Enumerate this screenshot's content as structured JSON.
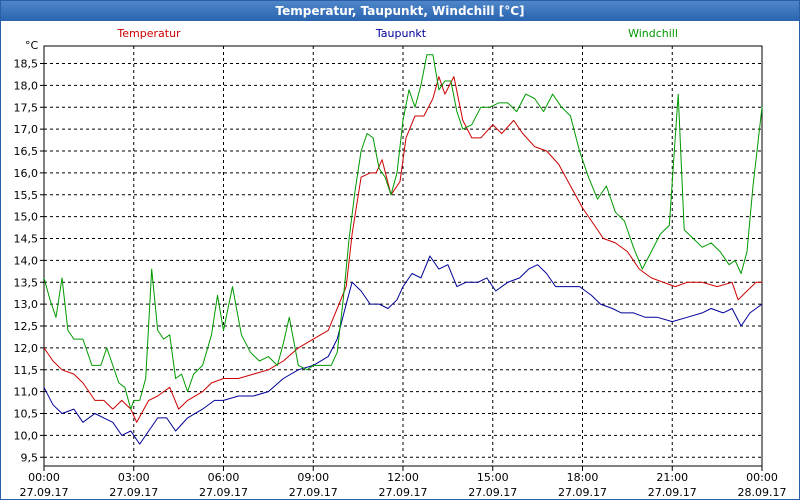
{
  "window": {
    "title": "Temperatur, Taupunkt, Windchill [°C]"
  },
  "chart_data": {
    "type": "line",
    "title": "Temperatur, Taupunkt, Windchill [°C]",
    "ylabel": "°C",
    "ylim": [
      9.3,
      18.9
    ],
    "y_ticks": [
      "9,5",
      "10,0",
      "10,5",
      "11,0",
      "11,5",
      "12,0",
      "12,5",
      "13,0",
      "13,5",
      "14,0",
      "14,5",
      "15,0",
      "15,5",
      "16,0",
      "16,5",
      "17,0",
      "17,5",
      "18,0",
      "18,5"
    ],
    "y_tick_values": [
      9.5,
      10,
      10.5,
      11,
      11.5,
      12,
      12.5,
      13,
      13.5,
      14,
      14.5,
      15,
      15.5,
      16,
      16.5,
      17,
      17.5,
      18,
      18.5
    ],
    "x_range_hours": [
      0,
      24
    ],
    "x_ticks": [
      {
        "h": 0,
        "time": "00:00",
        "date": "27.09.17"
      },
      {
        "h": 3,
        "time": "03:00",
        "date": "27.09.17"
      },
      {
        "h": 6,
        "time": "06:00",
        "date": "27.09.17"
      },
      {
        "h": 9,
        "time": "09:00",
        "date": "27.09.17"
      },
      {
        "h": 12,
        "time": "12:00",
        "date": "27.09.17"
      },
      {
        "h": 15,
        "time": "15:00",
        "date": "27.09.17"
      },
      {
        "h": 18,
        "time": "18:00",
        "date": "27.09.17"
      },
      {
        "h": 21,
        "time": "21:00",
        "date": "27.09.17"
      },
      {
        "h": 24,
        "time": "00:00",
        "date": "28.09.17"
      }
    ],
    "grid": true,
    "legend_position": "top",
    "series": [
      {
        "name": "Temperatur",
        "color": "#cc0000",
        "points": [
          [
            0,
            12.0
          ],
          [
            0.3,
            11.7
          ],
          [
            0.6,
            11.5
          ],
          [
            1.0,
            11.4
          ],
          [
            1.3,
            11.2
          ],
          [
            1.7,
            10.8
          ],
          [
            2.0,
            10.8
          ],
          [
            2.3,
            10.6
          ],
          [
            2.6,
            10.8
          ],
          [
            2.9,
            10.6
          ],
          [
            3.1,
            10.3
          ],
          [
            3.5,
            10.8
          ],
          [
            3.8,
            10.9
          ],
          [
            4.2,
            11.1
          ],
          [
            4.5,
            10.6
          ],
          [
            4.8,
            10.8
          ],
          [
            5.3,
            11.0
          ],
          [
            5.6,
            11.2
          ],
          [
            6.0,
            11.3
          ],
          [
            6.5,
            11.3
          ],
          [
            7.0,
            11.4
          ],
          [
            7.5,
            11.5
          ],
          [
            8.0,
            11.7
          ],
          [
            8.5,
            12.0
          ],
          [
            9.0,
            12.2
          ],
          [
            9.5,
            12.4
          ],
          [
            9.8,
            12.9
          ],
          [
            10.1,
            13.4
          ],
          [
            10.3,
            14.6
          ],
          [
            10.6,
            15.9
          ],
          [
            10.9,
            16.0
          ],
          [
            11.1,
            16.0
          ],
          [
            11.3,
            16.3
          ],
          [
            11.6,
            15.5
          ],
          [
            11.9,
            15.8
          ],
          [
            12.1,
            16.8
          ],
          [
            12.4,
            17.3
          ],
          [
            12.7,
            17.3
          ],
          [
            13.0,
            17.7
          ],
          [
            13.2,
            18.2
          ],
          [
            13.4,
            17.8
          ],
          [
            13.7,
            18.2
          ],
          [
            14.0,
            17.2
          ],
          [
            14.3,
            16.8
          ],
          [
            14.6,
            16.8
          ],
          [
            15.0,
            17.1
          ],
          [
            15.3,
            16.9
          ],
          [
            15.7,
            17.2
          ],
          [
            16.0,
            16.9
          ],
          [
            16.4,
            16.6
          ],
          [
            16.8,
            16.5
          ],
          [
            17.2,
            16.2
          ],
          [
            17.6,
            15.7
          ],
          [
            18.0,
            15.2
          ],
          [
            18.4,
            14.8
          ],
          [
            18.7,
            14.5
          ],
          [
            19.1,
            14.4
          ],
          [
            19.5,
            14.2
          ],
          [
            19.9,
            13.8
          ],
          [
            20.3,
            13.6
          ],
          [
            20.7,
            13.5
          ],
          [
            21.1,
            13.4
          ],
          [
            21.5,
            13.5
          ],
          [
            22.0,
            13.5
          ],
          [
            22.5,
            13.4
          ],
          [
            23.0,
            13.5
          ],
          [
            23.2,
            13.1
          ],
          [
            23.5,
            13.3
          ],
          [
            23.8,
            13.5
          ],
          [
            24.0,
            13.5
          ]
        ]
      },
      {
        "name": "Taupunkt",
        "color": "#000099",
        "points": [
          [
            0,
            11.1
          ],
          [
            0.3,
            10.7
          ],
          [
            0.6,
            10.5
          ],
          [
            1.0,
            10.6
          ],
          [
            1.3,
            10.3
          ],
          [
            1.7,
            10.5
          ],
          [
            2.0,
            10.4
          ],
          [
            2.3,
            10.3
          ],
          [
            2.6,
            10.0
          ],
          [
            2.9,
            10.1
          ],
          [
            3.2,
            9.8
          ],
          [
            3.5,
            10.1
          ],
          [
            3.8,
            10.4
          ],
          [
            4.1,
            10.4
          ],
          [
            4.4,
            10.1
          ],
          [
            4.8,
            10.4
          ],
          [
            5.3,
            10.6
          ],
          [
            5.7,
            10.8
          ],
          [
            6.0,
            10.8
          ],
          [
            6.5,
            10.9
          ],
          [
            7.0,
            10.9
          ],
          [
            7.5,
            11.0
          ],
          [
            8.0,
            11.3
          ],
          [
            8.5,
            11.5
          ],
          [
            9.0,
            11.6
          ],
          [
            9.5,
            11.8
          ],
          [
            9.8,
            12.2
          ],
          [
            10.1,
            13.0
          ],
          [
            10.3,
            13.5
          ],
          [
            10.6,
            13.3
          ],
          [
            10.9,
            13.0
          ],
          [
            11.2,
            13.0
          ],
          [
            11.5,
            12.9
          ],
          [
            11.8,
            13.1
          ],
          [
            12.0,
            13.4
          ],
          [
            12.3,
            13.7
          ],
          [
            12.6,
            13.6
          ],
          [
            12.9,
            14.1
          ],
          [
            13.2,
            13.8
          ],
          [
            13.5,
            13.9
          ],
          [
            13.8,
            13.4
          ],
          [
            14.1,
            13.5
          ],
          [
            14.5,
            13.5
          ],
          [
            14.8,
            13.6
          ],
          [
            15.1,
            13.3
          ],
          [
            15.5,
            13.5
          ],
          [
            15.9,
            13.6
          ],
          [
            16.2,
            13.8
          ],
          [
            16.5,
            13.9
          ],
          [
            16.8,
            13.7
          ],
          [
            17.1,
            13.4
          ],
          [
            17.5,
            13.4
          ],
          [
            17.9,
            13.4
          ],
          [
            18.3,
            13.2
          ],
          [
            18.6,
            13.0
          ],
          [
            19.0,
            12.9
          ],
          [
            19.3,
            12.8
          ],
          [
            19.7,
            12.8
          ],
          [
            20.1,
            12.7
          ],
          [
            20.5,
            12.7
          ],
          [
            21.0,
            12.6
          ],
          [
            21.5,
            12.7
          ],
          [
            22.0,
            12.8
          ],
          [
            22.3,
            12.9
          ],
          [
            22.7,
            12.8
          ],
          [
            23.0,
            12.9
          ],
          [
            23.3,
            12.5
          ],
          [
            23.6,
            12.8
          ],
          [
            24.0,
            13.0
          ]
        ]
      },
      {
        "name": "Windchill",
        "color": "#009900",
        "points": [
          [
            0,
            13.6
          ],
          [
            0.2,
            13.1
          ],
          [
            0.4,
            12.7
          ],
          [
            0.6,
            13.6
          ],
          [
            0.8,
            12.4
          ],
          [
            1.0,
            12.2
          ],
          [
            1.3,
            12.2
          ],
          [
            1.6,
            11.6
          ],
          [
            1.9,
            11.6
          ],
          [
            2.1,
            12.0
          ],
          [
            2.3,
            11.6
          ],
          [
            2.5,
            11.2
          ],
          [
            2.7,
            11.1
          ],
          [
            2.9,
            10.6
          ],
          [
            3.0,
            10.8
          ],
          [
            3.2,
            10.8
          ],
          [
            3.4,
            11.3
          ],
          [
            3.6,
            13.8
          ],
          [
            3.8,
            12.4
          ],
          [
            4.0,
            12.2
          ],
          [
            4.2,
            12.3
          ],
          [
            4.4,
            11.3
          ],
          [
            4.6,
            11.4
          ],
          [
            4.8,
            11.0
          ],
          [
            5.0,
            11.4
          ],
          [
            5.3,
            11.6
          ],
          [
            5.6,
            12.3
          ],
          [
            5.8,
            13.2
          ],
          [
            6.0,
            12.4
          ],
          [
            6.3,
            13.4
          ],
          [
            6.6,
            12.3
          ],
          [
            6.9,
            11.9
          ],
          [
            7.2,
            11.7
          ],
          [
            7.5,
            11.8
          ],
          [
            7.8,
            11.6
          ],
          [
            8.0,
            12.1
          ],
          [
            8.2,
            12.7
          ],
          [
            8.5,
            11.6
          ],
          [
            8.8,
            11.5
          ],
          [
            9.0,
            11.6
          ],
          [
            9.3,
            11.6
          ],
          [
            9.6,
            11.6
          ],
          [
            9.8,
            11.9
          ],
          [
            10.0,
            13.1
          ],
          [
            10.2,
            14.5
          ],
          [
            10.4,
            15.6
          ],
          [
            10.6,
            16.5
          ],
          [
            10.8,
            16.9
          ],
          [
            11.0,
            16.8
          ],
          [
            11.2,
            16.1
          ],
          [
            11.4,
            15.9
          ],
          [
            11.6,
            15.5
          ],
          [
            11.8,
            16.0
          ],
          [
            12.0,
            17.2
          ],
          [
            12.2,
            17.9
          ],
          [
            12.4,
            17.5
          ],
          [
            12.6,
            18.0
          ],
          [
            12.8,
            18.7
          ],
          [
            13.0,
            18.7
          ],
          [
            13.2,
            17.9
          ],
          [
            13.4,
            18.1
          ],
          [
            13.6,
            18.1
          ],
          [
            13.8,
            17.4
          ],
          [
            14.0,
            17.0
          ],
          [
            14.3,
            17.1
          ],
          [
            14.6,
            17.5
          ],
          [
            14.9,
            17.5
          ],
          [
            15.2,
            17.6
          ],
          [
            15.5,
            17.6
          ],
          [
            15.8,
            17.4
          ],
          [
            16.1,
            17.8
          ],
          [
            16.4,
            17.7
          ],
          [
            16.7,
            17.4
          ],
          [
            17.0,
            17.8
          ],
          [
            17.3,
            17.5
          ],
          [
            17.6,
            17.3
          ],
          [
            17.9,
            16.5
          ],
          [
            18.2,
            15.9
          ],
          [
            18.5,
            15.4
          ],
          [
            18.8,
            15.7
          ],
          [
            19.1,
            15.1
          ],
          [
            19.4,
            14.9
          ],
          [
            19.7,
            14.3
          ],
          [
            20.0,
            13.8
          ],
          [
            20.3,
            14.2
          ],
          [
            20.6,
            14.6
          ],
          [
            20.9,
            14.8
          ],
          [
            21.2,
            17.8
          ],
          [
            21.4,
            14.7
          ],
          [
            21.7,
            14.5
          ],
          [
            22.0,
            14.3
          ],
          [
            22.3,
            14.4
          ],
          [
            22.6,
            14.2
          ],
          [
            22.9,
            13.9
          ],
          [
            23.1,
            14.0
          ],
          [
            23.3,
            13.7
          ],
          [
            23.5,
            14.2
          ],
          [
            23.7,
            15.7
          ],
          [
            24.0,
            17.5
          ]
        ]
      }
    ]
  }
}
